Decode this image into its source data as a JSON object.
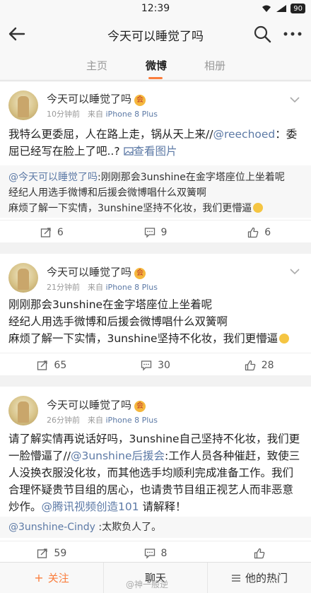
{
  "status": {
    "time": "12:39",
    "battery": "90"
  },
  "nav": {
    "title": "今天可以睡觉了吗"
  },
  "tabs": [
    {
      "label": "主页"
    },
    {
      "label": "微博"
    },
    {
      "label": "相册"
    }
  ],
  "posts": [
    {
      "name": "今天可以睡觉了吗",
      "time": "10分钟前",
      "source_prefix": "来自",
      "source": "iPhone 8 Plus",
      "text_part1": "我特么更委屈，人在路上走，锅从天上来//",
      "mention": "@reechoed",
      "text_part2": "：委屈已经写在脸上了吧..?",
      "view_image": "查看图片",
      "repost_author": "@今天可以睡觉了吗",
      "repost_line1": ":刚刚那会3unshine在金字塔座位上坐着呢",
      "repost_line2": "经纪人用选手微博和后援会微博唱什么双簧啊",
      "repost_line3": "麻烦了解一下实情，3unshine坚持不化妆，我们更懵逼",
      "reposts": "6",
      "comments": "9",
      "likes": "6"
    },
    {
      "name": "今天可以睡觉了吗",
      "time": "21分钟前",
      "source_prefix": "来自",
      "source": "iPhone 8 Plus",
      "line1": "刚刚那会3unshine在金字塔座位上坐着呢",
      "line2": "经纪人用选手微博和后援会微博唱什么双簧啊",
      "line3": "麻烦了解一下实情，3unshine坚持不化妆，我们更懵逼",
      "reposts": "65",
      "comments": "30",
      "likes": "28"
    },
    {
      "name": "今天可以睡觉了吗",
      "time": "26分钟前",
      "source_prefix": "来自",
      "source": "iPhone 8 Plus",
      "text_part1": "请了解实情再说话好吗，3unshine自己坚持不化妆，我们更一脸懵逼了//",
      "mention1": "@3unshine后援会",
      "text_part2": ":工作人员各种催赶，致使三人没换衣服没化妆，而其他选手均顺利完成准备工作。我们合理怀疑贵节目组的居心，也请贵节目组正视艺人而非恶意炒作。",
      "mention2": "@腾讯视频创造101",
      "text_part3": " 请解释！",
      "repost_author": "@3unshine-Cindy",
      "repost_text": " :太欺负人了。",
      "reposts": "59",
      "comments": "8"
    }
  ],
  "bottom": {
    "follow": "关注",
    "chat": "聊天",
    "hot": "他的热门"
  },
  "watermark": "@神一般逆",
  "colors": {
    "accent": "#fa7d3c",
    "link": "#5d7aa6"
  }
}
